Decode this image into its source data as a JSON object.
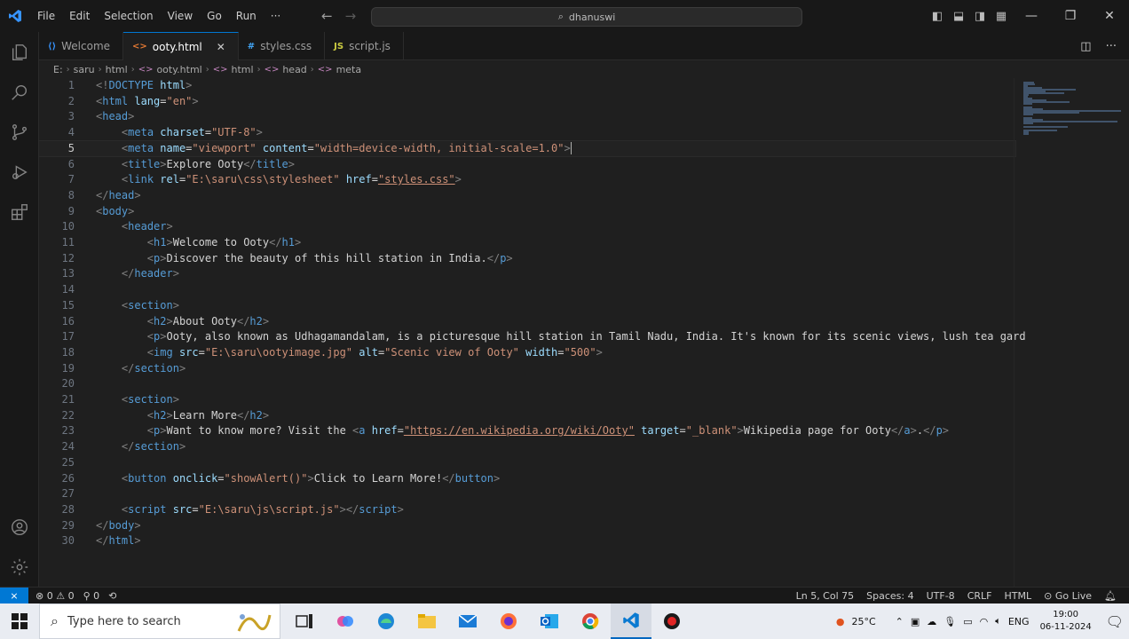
{
  "menu": [
    "File",
    "Edit",
    "Selection",
    "View",
    "Go",
    "Run",
    "···"
  ],
  "command_center": {
    "text": "dhanuswi"
  },
  "tabs": [
    {
      "label": "Welcome",
      "icon": "vscode-icon",
      "icon_text": "⟨⟩",
      "color": "#3794ff"
    },
    {
      "label": "ooty.html",
      "icon": "html-icon",
      "icon_text": "<>",
      "color": "#e37933",
      "active": true,
      "close": "✕"
    },
    {
      "label": "styles.css",
      "icon": "css-icon",
      "icon_text": "#",
      "color": "#42a5f5"
    },
    {
      "label": "script.js",
      "icon": "js-icon",
      "icon_text": "JS",
      "color": "#cbcb41"
    }
  ],
  "breadcrumb": [
    "E:",
    "saru",
    "html",
    "ooty.html",
    "html",
    "head",
    "meta"
  ],
  "editor": {
    "current_line": 5,
    "lines": [
      [
        [
          "tgb",
          "<!"
        ],
        [
          "tg",
          "DOCTYPE "
        ],
        [
          "at",
          "html"
        ],
        [
          "tgb",
          ">"
        ]
      ],
      [
        [
          "tgb",
          "<"
        ],
        [
          "tg",
          "html "
        ],
        [
          "at",
          "lang"
        ],
        [
          "tx",
          "="
        ],
        [
          "st",
          "\"en\""
        ],
        [
          "tgb",
          ">"
        ]
      ],
      [
        [
          "tgb",
          "<"
        ],
        [
          "tg",
          "head"
        ],
        [
          "tgb",
          ">"
        ]
      ],
      [
        [
          "tx",
          "    "
        ],
        [
          "tgb",
          "<"
        ],
        [
          "tg",
          "meta "
        ],
        [
          "at",
          "charset"
        ],
        [
          "tx",
          "="
        ],
        [
          "st",
          "\"UTF-8\""
        ],
        [
          "tgb",
          ">"
        ]
      ],
      [
        [
          "tx",
          "    "
        ],
        [
          "tgb",
          "<"
        ],
        [
          "tg",
          "meta "
        ],
        [
          "at",
          "name"
        ],
        [
          "tx",
          "="
        ],
        [
          "st",
          "\"viewport\" "
        ],
        [
          "at",
          "content"
        ],
        [
          "tx",
          "="
        ],
        [
          "st",
          "\"width=device-width, initial-scale=1.0\""
        ],
        [
          "tgb",
          ">"
        ]
      ],
      [
        [
          "tx",
          "    "
        ],
        [
          "tgb",
          "<"
        ],
        [
          "tg",
          "title"
        ],
        [
          "tgb",
          ">"
        ],
        [
          "tx",
          "Explore Ooty"
        ],
        [
          "tgb",
          "</"
        ],
        [
          "tg",
          "title"
        ],
        [
          "tgb",
          ">"
        ]
      ],
      [
        [
          "tx",
          "    "
        ],
        [
          "tgb",
          "<"
        ],
        [
          "tg",
          "link "
        ],
        [
          "at",
          "rel"
        ],
        [
          "tx",
          "="
        ],
        [
          "st",
          "\"E:\\saru\\css\\stylesheet\" "
        ],
        [
          "at",
          "href"
        ],
        [
          "tx",
          "="
        ],
        [
          "stu",
          "\"styles.css\""
        ],
        [
          "tgb",
          ">"
        ]
      ],
      [
        [
          "tgb",
          "</"
        ],
        [
          "tg",
          "head"
        ],
        [
          "tgb",
          ">"
        ]
      ],
      [
        [
          "tgb",
          "<"
        ],
        [
          "tg",
          "body"
        ],
        [
          "tgb",
          ">"
        ]
      ],
      [
        [
          "tx",
          "    "
        ],
        [
          "tgb",
          "<"
        ],
        [
          "tg",
          "header"
        ],
        [
          "tgb",
          ">"
        ]
      ],
      [
        [
          "tx",
          "        "
        ],
        [
          "tgb",
          "<"
        ],
        [
          "tg",
          "h1"
        ],
        [
          "tgb",
          ">"
        ],
        [
          "tx",
          "Welcome to Ooty"
        ],
        [
          "tgb",
          "</"
        ],
        [
          "tg",
          "h1"
        ],
        [
          "tgb",
          ">"
        ]
      ],
      [
        [
          "tx",
          "        "
        ],
        [
          "tgb",
          "<"
        ],
        [
          "tg",
          "p"
        ],
        [
          "tgb",
          ">"
        ],
        [
          "tx",
          "Discover the beauty of this hill station in India."
        ],
        [
          "tgb",
          "</"
        ],
        [
          "tg",
          "p"
        ],
        [
          "tgb",
          ">"
        ]
      ],
      [
        [
          "tx",
          "    "
        ],
        [
          "tgb",
          "</"
        ],
        [
          "tg",
          "header"
        ],
        [
          "tgb",
          ">"
        ]
      ],
      [],
      [
        [
          "tx",
          "    "
        ],
        [
          "tgb",
          "<"
        ],
        [
          "tg",
          "section"
        ],
        [
          "tgb",
          ">"
        ]
      ],
      [
        [
          "tx",
          "        "
        ],
        [
          "tgb",
          "<"
        ],
        [
          "tg",
          "h2"
        ],
        [
          "tgb",
          ">"
        ],
        [
          "tx",
          "About Ooty"
        ],
        [
          "tgb",
          "</"
        ],
        [
          "tg",
          "h2"
        ],
        [
          "tgb",
          ">"
        ]
      ],
      [
        [
          "tx",
          "        "
        ],
        [
          "tgb",
          "<"
        ],
        [
          "tg",
          "p"
        ],
        [
          "tgb",
          ">"
        ],
        [
          "tx",
          "Ooty, also known as Udhagamandalam, is a picturesque hill station in Tamil Nadu, India. It's known for its scenic views, lush tea gard"
        ]
      ],
      [
        [
          "tx",
          "        "
        ],
        [
          "tgb",
          "<"
        ],
        [
          "tg",
          "img "
        ],
        [
          "at",
          "src"
        ],
        [
          "tx",
          "="
        ],
        [
          "st",
          "\"E:\\saru\\ootyimage.jpg\" "
        ],
        [
          "at",
          "alt"
        ],
        [
          "tx",
          "="
        ],
        [
          "st",
          "\"Scenic view of Ooty\" "
        ],
        [
          "at",
          "width"
        ],
        [
          "tx",
          "="
        ],
        [
          "st",
          "\"500\""
        ],
        [
          "tgb",
          ">"
        ]
      ],
      [
        [
          "tx",
          "    "
        ],
        [
          "tgb",
          "</"
        ],
        [
          "tg",
          "section"
        ],
        [
          "tgb",
          ">"
        ]
      ],
      [],
      [
        [
          "tx",
          "    "
        ],
        [
          "tgb",
          "<"
        ],
        [
          "tg",
          "section"
        ],
        [
          "tgb",
          ">"
        ]
      ],
      [
        [
          "tx",
          "        "
        ],
        [
          "tgb",
          "<"
        ],
        [
          "tg",
          "h2"
        ],
        [
          "tgb",
          ">"
        ],
        [
          "tx",
          "Learn More"
        ],
        [
          "tgb",
          "</"
        ],
        [
          "tg",
          "h2"
        ],
        [
          "tgb",
          ">"
        ]
      ],
      [
        [
          "tx",
          "        "
        ],
        [
          "tgb",
          "<"
        ],
        [
          "tg",
          "p"
        ],
        [
          "tgb",
          ">"
        ],
        [
          "tx",
          "Want to know more? Visit the "
        ],
        [
          "tgb",
          "<"
        ],
        [
          "tg",
          "a "
        ],
        [
          "at",
          "href"
        ],
        [
          "tx",
          "="
        ],
        [
          "stu",
          "\"https://en.wikipedia.org/wiki/Ooty\""
        ],
        [
          "at",
          " target"
        ],
        [
          "tx",
          "="
        ],
        [
          "st",
          "\"_blank\""
        ],
        [
          "tgb",
          ">"
        ],
        [
          "tx",
          "Wikipedia page for Ooty"
        ],
        [
          "tgb",
          "</"
        ],
        [
          "tg",
          "a"
        ],
        [
          "tgb",
          ">"
        ],
        [
          "tx",
          "."
        ],
        [
          "tgb",
          "</"
        ],
        [
          "tg",
          "p"
        ],
        [
          "tgb",
          ">"
        ]
      ],
      [
        [
          "tx",
          "    "
        ],
        [
          "tgb",
          "</"
        ],
        [
          "tg",
          "section"
        ],
        [
          "tgb",
          ">"
        ]
      ],
      [],
      [
        [
          "tx",
          "    "
        ],
        [
          "tgb",
          "<"
        ],
        [
          "tg",
          "button "
        ],
        [
          "at",
          "onclick"
        ],
        [
          "tx",
          "="
        ],
        [
          "st",
          "\"showAlert()\""
        ],
        [
          "tgb",
          ">"
        ],
        [
          "tx",
          "Click to Learn More!"
        ],
        [
          "tgb",
          "</"
        ],
        [
          "tg",
          "button"
        ],
        [
          "tgb",
          ">"
        ]
      ],
      [],
      [
        [
          "tx",
          "    "
        ],
        [
          "tgb",
          "<"
        ],
        [
          "tg",
          "script "
        ],
        [
          "at",
          "src"
        ],
        [
          "tx",
          "="
        ],
        [
          "st",
          "\"E:\\saru\\js\\script.js\""
        ],
        [
          "tgb",
          "></"
        ],
        [
          "tg",
          "script"
        ],
        [
          "tgb",
          ">"
        ]
      ],
      [
        [
          "tgb",
          "</"
        ],
        [
          "tg",
          "body"
        ],
        [
          "tgb",
          ">"
        ]
      ],
      [
        [
          "tgb",
          "</"
        ],
        [
          "tg",
          "html"
        ],
        [
          "tgb",
          ">"
        ]
      ]
    ]
  },
  "status": {
    "remote": "⨯",
    "errors": "0",
    "warnings": "0",
    "ports": "0",
    "position": "Ln 5, Col 75",
    "spaces": "Spaces: 4",
    "encoding": "UTF-8",
    "eol": "CRLF",
    "language": "HTML",
    "go_live": "Go Live"
  },
  "taskbar": {
    "search_placeholder": "Type here to search",
    "weather": "25°C",
    "lang": "ENG",
    "time": "19:00",
    "date": "06-11-2024"
  },
  "colors": {
    "accent": "#0078d4",
    "editor_bg": "#1f1f1f",
    "chrome_bg": "#181818"
  }
}
